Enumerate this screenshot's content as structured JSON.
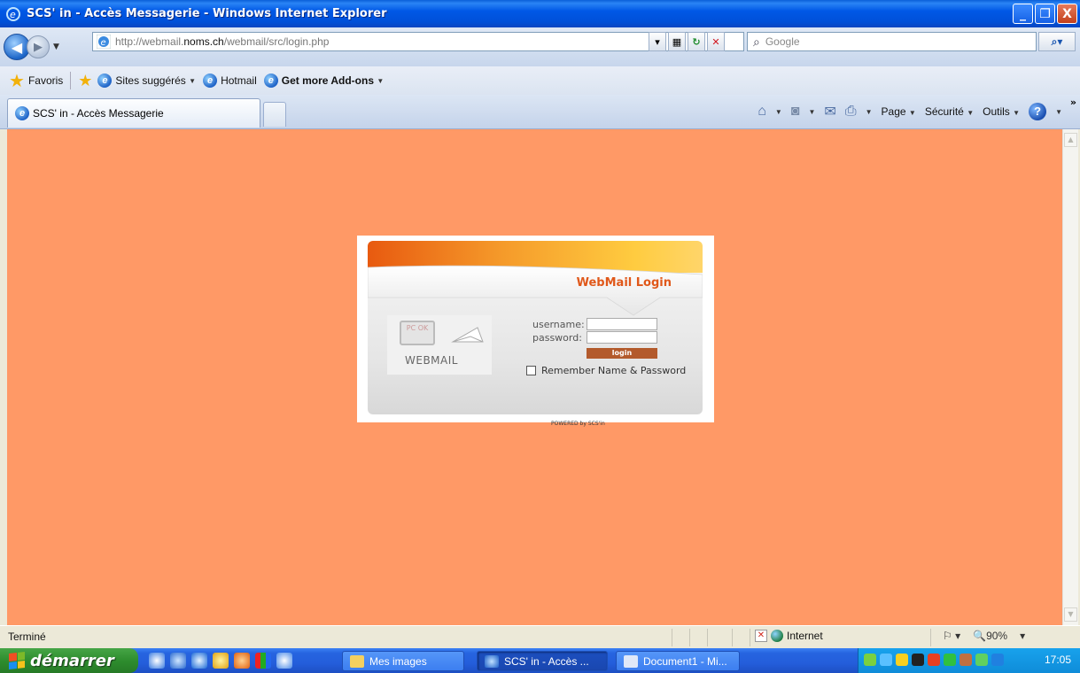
{
  "window": {
    "title": "SCS' in - Accès Messagerie - Windows Internet Explorer",
    "minimize_label": "_",
    "maximize_label": "❐",
    "close_label": "X"
  },
  "address_bar": {
    "url_prefix": "http://webmail.",
    "url_domain": "noms.ch",
    "url_path": "/webmail/src/login.php",
    "search_placeholder": "Google"
  },
  "favorites_bar": {
    "favorites_label": "Favoris",
    "items": [
      {
        "label": "Sites suggérés",
        "dropdown": true
      },
      {
        "label": "Hotmail",
        "dropdown": false
      },
      {
        "label": "Get more Add-ons",
        "dropdown": true
      }
    ]
  },
  "tabs": [
    {
      "label": "SCS' in - Accès Messagerie",
      "active": true
    }
  ],
  "command_bar": {
    "page_label": "Page",
    "security_label": "Sécurité",
    "tools_label": "Outils"
  },
  "login": {
    "heading": "WebMail Login",
    "image_label": "WEBMAIL",
    "image_badge": "PC OK",
    "username_label": "username:",
    "password_label": "password:",
    "username_value": "",
    "password_value": "",
    "login_button": "login",
    "remember_label": "Remember Name & Password",
    "remember_checked": false,
    "powered_by": "POWERED by SCS'in"
  },
  "status_bar": {
    "status_text": "Terminé",
    "zone_label": "Internet",
    "zoom_label": "90%"
  },
  "taskbar": {
    "start_label": "démarrer",
    "items": [
      {
        "label": "Mes images",
        "active": false
      },
      {
        "label": "SCS' in - Accès ...",
        "active": true
      },
      {
        "label": "Document1 - Mi...",
        "active": false
      }
    ],
    "clock": "17:05"
  },
  "colors": {
    "page_background": "#ff9966",
    "heading_orange": "#e0581a",
    "login_button": "#b35a2c"
  }
}
